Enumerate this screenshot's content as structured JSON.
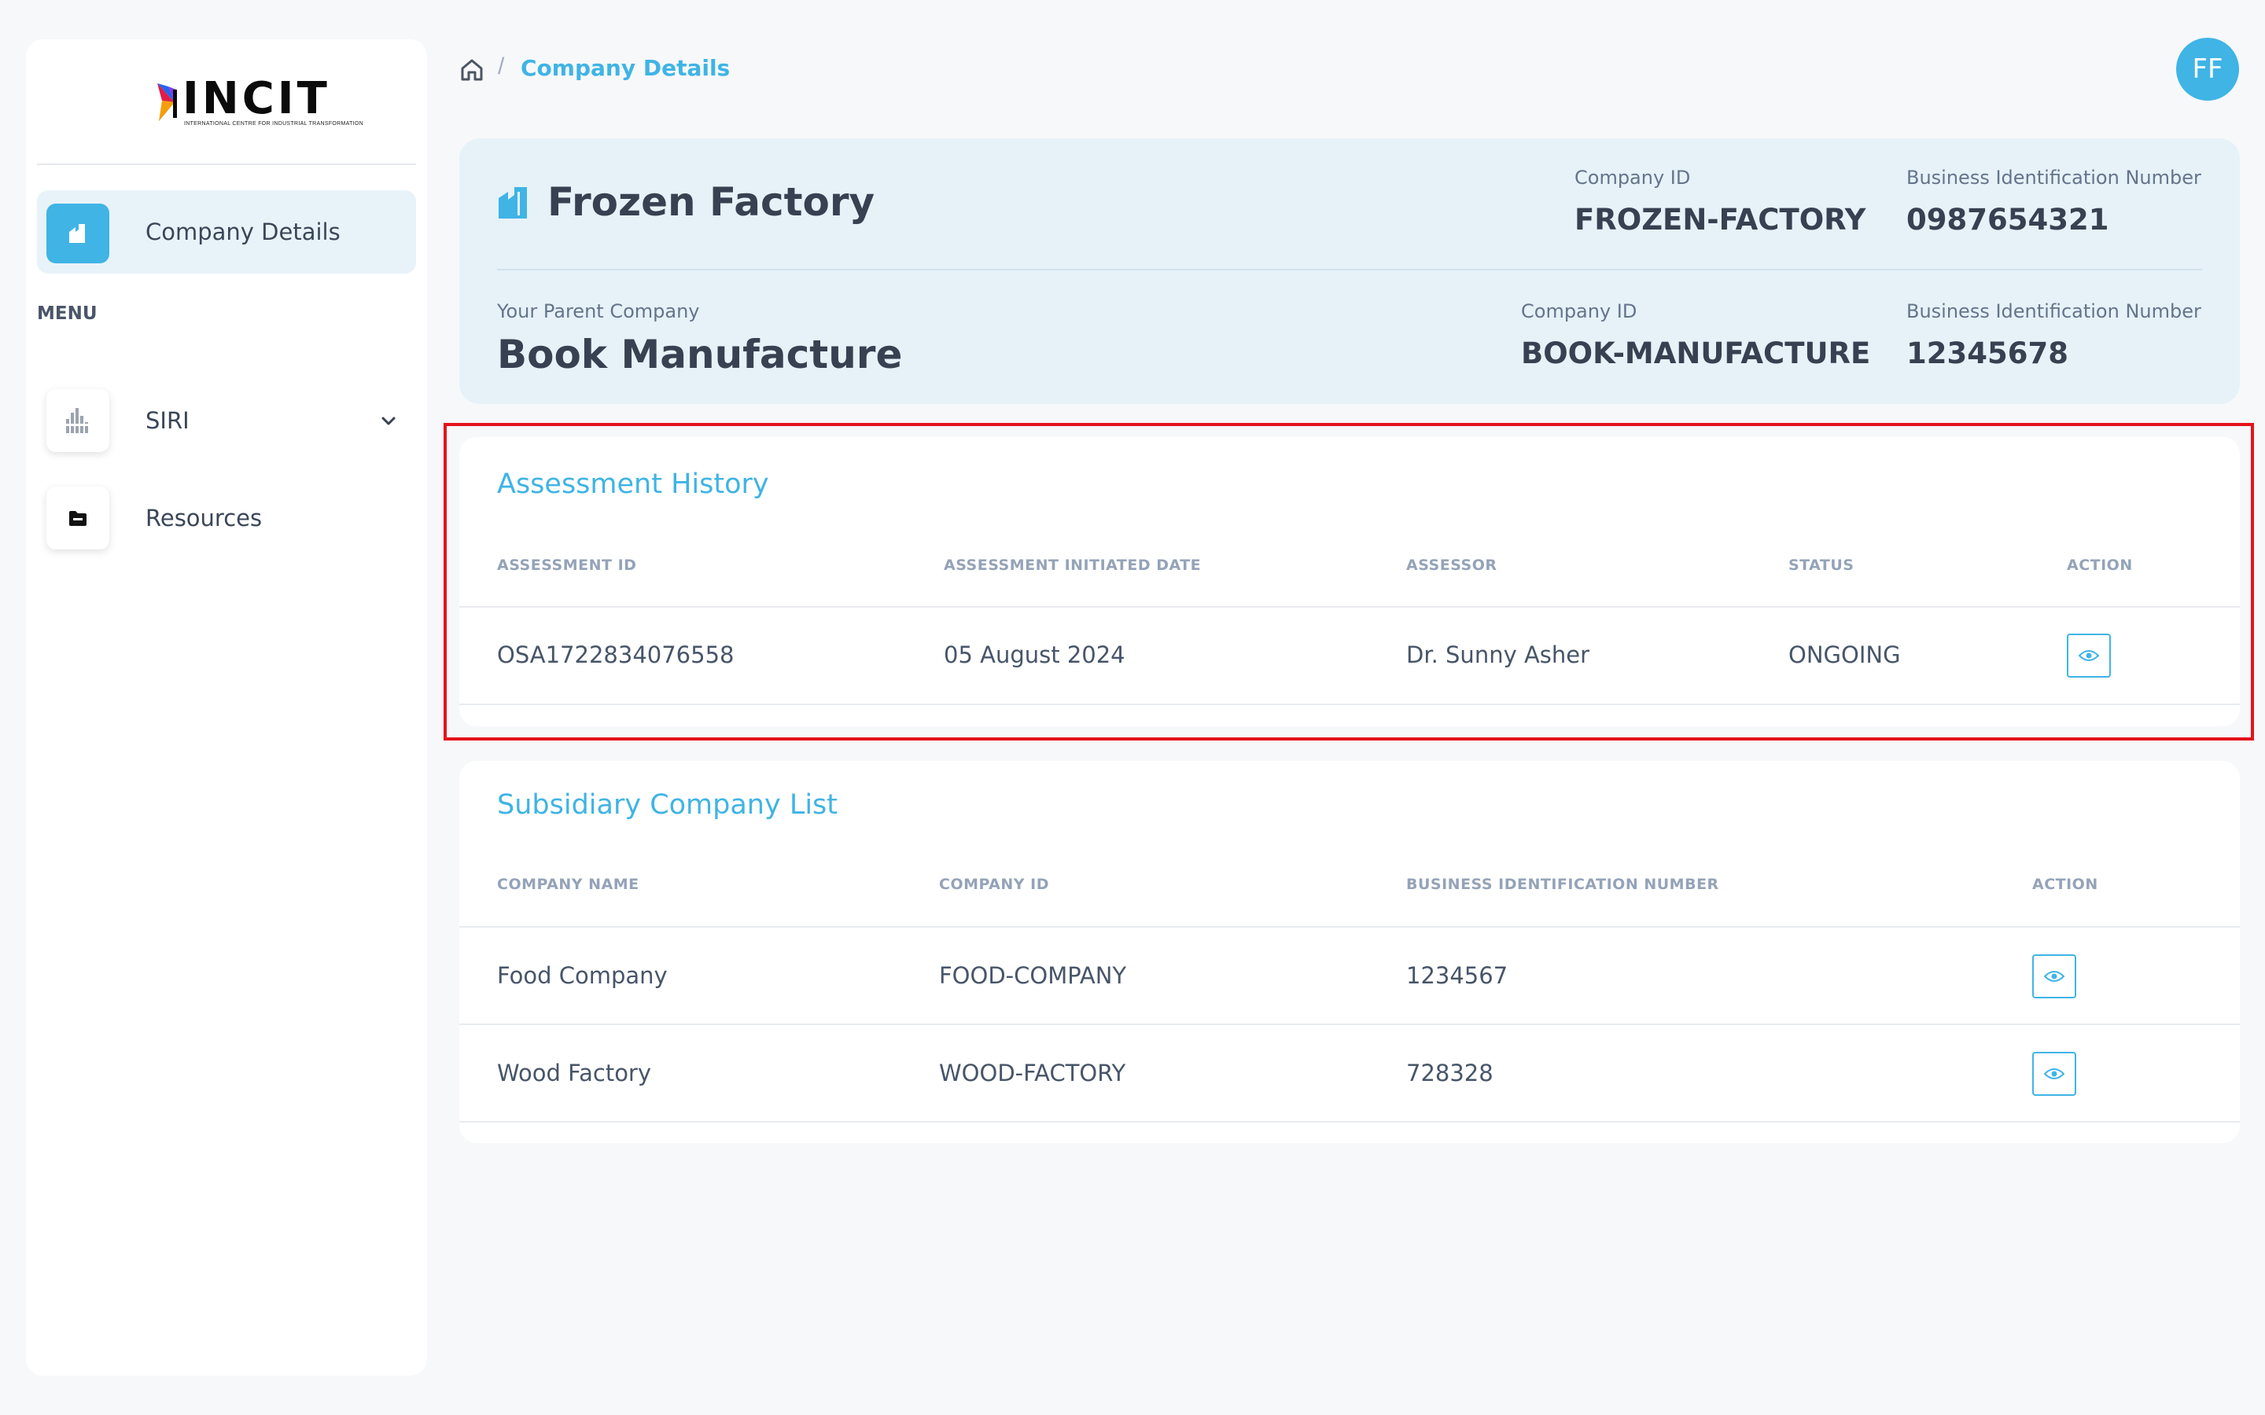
{
  "brand": {
    "logo_text": "INCIT",
    "logo_tagline": "INTERNATIONAL CENTRE FOR INDUSTRIAL TRANSFORMATION"
  },
  "sidebar": {
    "active_item": {
      "label": "Company Details",
      "icon": "company-icon"
    },
    "menu_heading": "MENU",
    "items": [
      {
        "label": "SIRI",
        "icon": "chart-icon",
        "expandable": true
      },
      {
        "label": "Resources",
        "icon": "folder-icon",
        "expandable": false
      }
    ]
  },
  "header": {
    "breadcrumb": {
      "separator": "/",
      "current": "Company Details"
    },
    "avatar_initials": "FF"
  },
  "company": {
    "name": "Frozen Factory",
    "id_label": "Company ID",
    "id_value": "FROZEN-FACTORY",
    "bin_label": "Business Identification Number",
    "bin_value": "0987654321",
    "parent_label": "Your Parent Company",
    "parent_name": "Book Manufacture",
    "parent_id_label": "Company ID",
    "parent_id_value": "BOOK-MANUFACTURE",
    "parent_bin_label": "Business Identification Number",
    "parent_bin_value": "12345678"
  },
  "assessment_history": {
    "title": "Assessment History",
    "columns": [
      "ASSESSMENT ID",
      "ASSESSMENT INITIATED DATE",
      "ASSESSOR",
      "STATUS",
      "ACTION"
    ],
    "rows": [
      {
        "id": "OSA1722834076558",
        "date": "05 August 2024",
        "assessor": "Dr. Sunny Asher",
        "status": "ONGOING"
      }
    ]
  },
  "subsidiaries": {
    "title": "Subsidiary Company List",
    "columns": [
      "COMPANY NAME",
      "COMPANY ID",
      "BUSINESS IDENTIFICATION NUMBER",
      "ACTION"
    ],
    "rows": [
      {
        "name": "Food Company",
        "id": "FOOD-COMPANY",
        "bin": "1234567"
      },
      {
        "name": "Wood Factory",
        "id": "WOOD-FACTORY",
        "bin": "728328"
      }
    ]
  },
  "colors": {
    "accent": "#3fb4e5",
    "card_bg": "#e6f2f8",
    "highlight": "#e5131b",
    "page_bg": "#f7f8fa"
  }
}
